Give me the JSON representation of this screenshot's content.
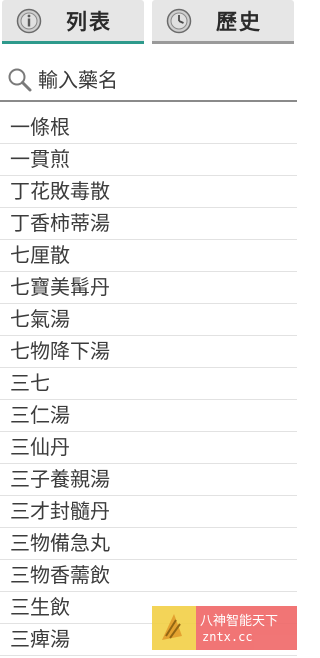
{
  "tabs": [
    {
      "label": "列表",
      "icon": "info-icon",
      "active": true
    },
    {
      "label": "歷史",
      "icon": "clock-icon",
      "active": false
    }
  ],
  "search": {
    "placeholder": "輸入藥名",
    "icon": "search-icon"
  },
  "herbs": [
    "一條根",
    "一貫煎",
    "丁花敗毒散",
    "丁香柿蒂湯",
    "七厘散",
    "七寶美髯丹",
    "七氣湯",
    "七物降下湯",
    "三七",
    "三仁湯",
    "三仙丹",
    "三子養親湯",
    "三才封髓丹",
    "三物備急丸",
    "三物香薷飲",
    "三生飲",
    "三痺湯"
  ],
  "watermark": {
    "title": "八神智能天下",
    "url": "zntx.cc"
  },
  "colors": {
    "accent": "#2e9a8c",
    "inactive_underline": "#9a9a9a",
    "tab_bg": "#e6e6e6",
    "watermark_bg": "#f06a6a"
  }
}
